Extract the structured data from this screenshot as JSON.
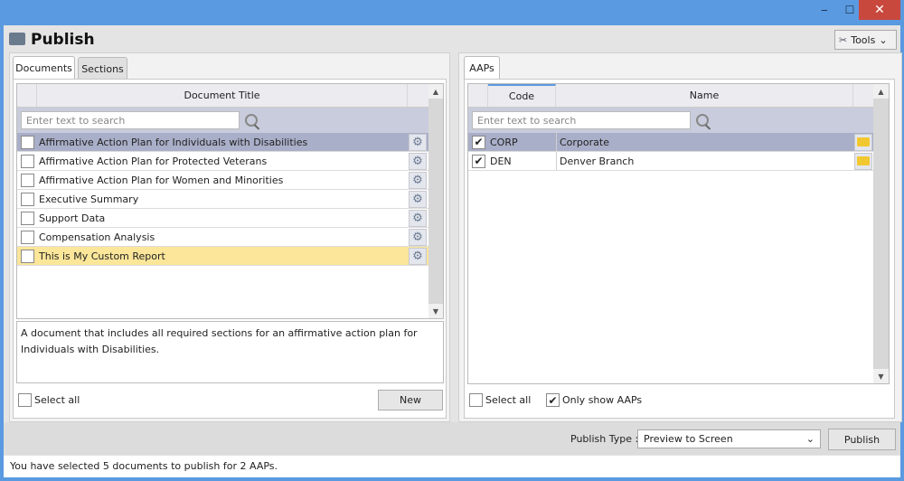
{
  "window": {
    "minimize": "‒",
    "maximize": "☐",
    "close": "✕"
  },
  "header": {
    "title": "Publish",
    "tools_label": "Tools"
  },
  "left": {
    "tabs": [
      "Documents",
      "Sections"
    ],
    "column": "Document Title",
    "search_placeholder": "Enter text to search",
    "rows": [
      {
        "title": "Affirmative Action Plan for Individuals with Disabilities",
        "checked": false
      },
      {
        "title": "Affirmative Action Plan for Protected Veterans",
        "checked": false
      },
      {
        "title": "Affirmative Action Plan for Women and Minorities",
        "checked": false
      },
      {
        "title": "Executive Summary",
        "checked": false
      },
      {
        "title": "Support Data",
        "checked": false
      },
      {
        "title": "Compensation Analysis",
        "checked": false
      },
      {
        "title": "This is My Custom Report",
        "checked": false
      }
    ],
    "description": "A document that includes all required sections for an affirmative action plan for Individuals with Disabilities.",
    "select_all": "Select all",
    "new_button": "New"
  },
  "right": {
    "tab": "AAPs",
    "columns": {
      "code": "Code",
      "name": "Name"
    },
    "search_placeholder": "Enter text to search",
    "rows": [
      {
        "code": "CORP",
        "name": "Corporate",
        "checked": true
      },
      {
        "code": "DEN",
        "name": "Denver Branch",
        "checked": true
      }
    ],
    "select_all": "Select all",
    "only_show": "Only show AAPs"
  },
  "footer": {
    "publish_type_label": "Publish Type :",
    "publish_type_value": "Preview to Screen",
    "publish_button": "Publish"
  },
  "status": "You have selected 5 documents to publish for 2 AAPs."
}
